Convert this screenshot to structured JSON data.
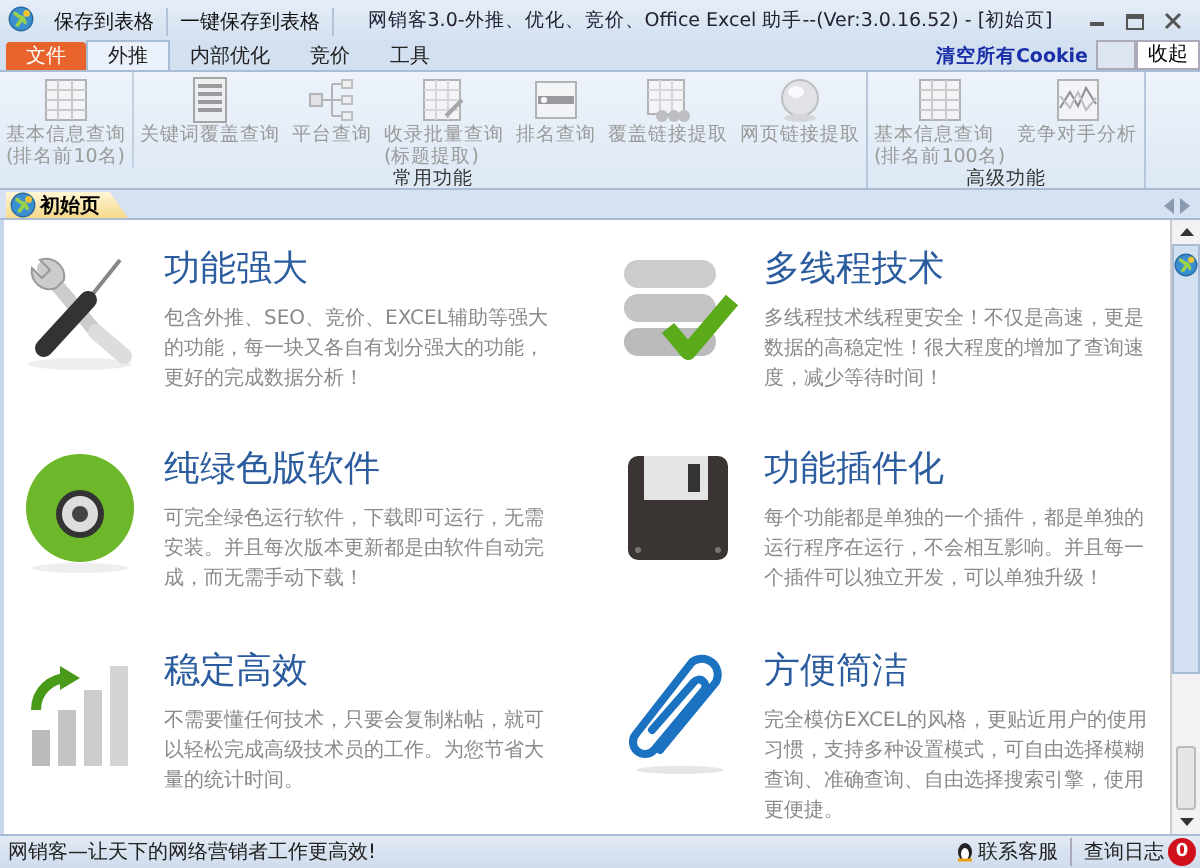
{
  "quick_toolbar": [
    {
      "label": "保存到表格"
    },
    {
      "label": "一键保存到表格"
    }
  ],
  "window": {
    "title": "网销客3.0-外推、优化、竞价、Office Excel 助手--(Ver:3.0.16.52) - [初始页]"
  },
  "menu_tabs": [
    {
      "label": "文件",
      "kind": "file",
      "selected": false
    },
    {
      "label": "外推",
      "kind": "tab",
      "selected": true
    },
    {
      "label": "内部优化",
      "kind": "tab",
      "selected": false
    },
    {
      "label": "竞价",
      "kind": "tab",
      "selected": false
    },
    {
      "label": "工具",
      "kind": "tab",
      "selected": false
    }
  ],
  "ribbon_actions": {
    "clear_cookie": "清空所有Cookie",
    "collapse": "收起"
  },
  "ribbon_groups": [
    {
      "title": "常用功能",
      "buttons": [
        {
          "lines": [
            "基本信息查询",
            "(排名前10名)"
          ],
          "disabled": true
        },
        {
          "lines": [
            "关键词覆盖查询"
          ],
          "disabled": true
        },
        {
          "lines": [
            "平台查询"
          ],
          "disabled": true
        },
        {
          "lines": [
            "收录批量查询",
            "(标题提取)"
          ],
          "disabled": true
        },
        {
          "lines": [
            "排名查询"
          ],
          "disabled": true
        },
        {
          "lines": [
            "覆盖链接提取"
          ],
          "disabled": true
        },
        {
          "lines": [
            "网页链接提取"
          ],
          "disabled": true
        }
      ]
    },
    {
      "title": "高级功能",
      "buttons": [
        {
          "lines": [
            "基本信息查询",
            "(排名前100名)"
          ],
          "disabled": true
        },
        {
          "lines": [
            "竞争对手分析"
          ],
          "disabled": true
        }
      ]
    }
  ],
  "doc_tabs": [
    {
      "label": "初始页",
      "selected": true
    }
  ],
  "features": [
    {
      "title": "功能强大",
      "description": "包含外推、SEO、竞价、EXCEL辅助等强大的功能，每一块又各自有划分强大的功能，更好的完成数据分析！"
    },
    {
      "title": "多线程技术",
      "description": "多线程技术线程更安全！不仅是高速，更是数据的高稳定性！很大程度的增加了查询速度，减少等待时间！"
    },
    {
      "title": "纯绿色版软件",
      "description": "可完全绿色运行软件，下载即可运行，无需安装。并且每次版本更新都是由软件自动完成，而无需手动下载！"
    },
    {
      "title": "功能插件化",
      "description": "每个功能都是单独的一个插件，都是单独的运行程序在运行，不会相互影响。并且每一个插件可以独立开发，可以单独升级！"
    },
    {
      "title": "稳定高效",
      "description": "不需要懂任何技术，只要会复制粘帖，就可以轻松完成高级技术员的工作。为您节省大量的统计时间。"
    },
    {
      "title": "方便简洁",
      "description": "完全模仿EXCEL的风格，更贴近用户的使用习惯，支持多种设置模式，可自由选择模糊查询、准确查询、自由选择搜索引擎，使用更便捷。"
    }
  ],
  "status_bar": {
    "message": "网销客—让天下的网络营销者工作更高效!",
    "contact": "联系客服",
    "log": "查询日志",
    "log_badge": "0"
  }
}
